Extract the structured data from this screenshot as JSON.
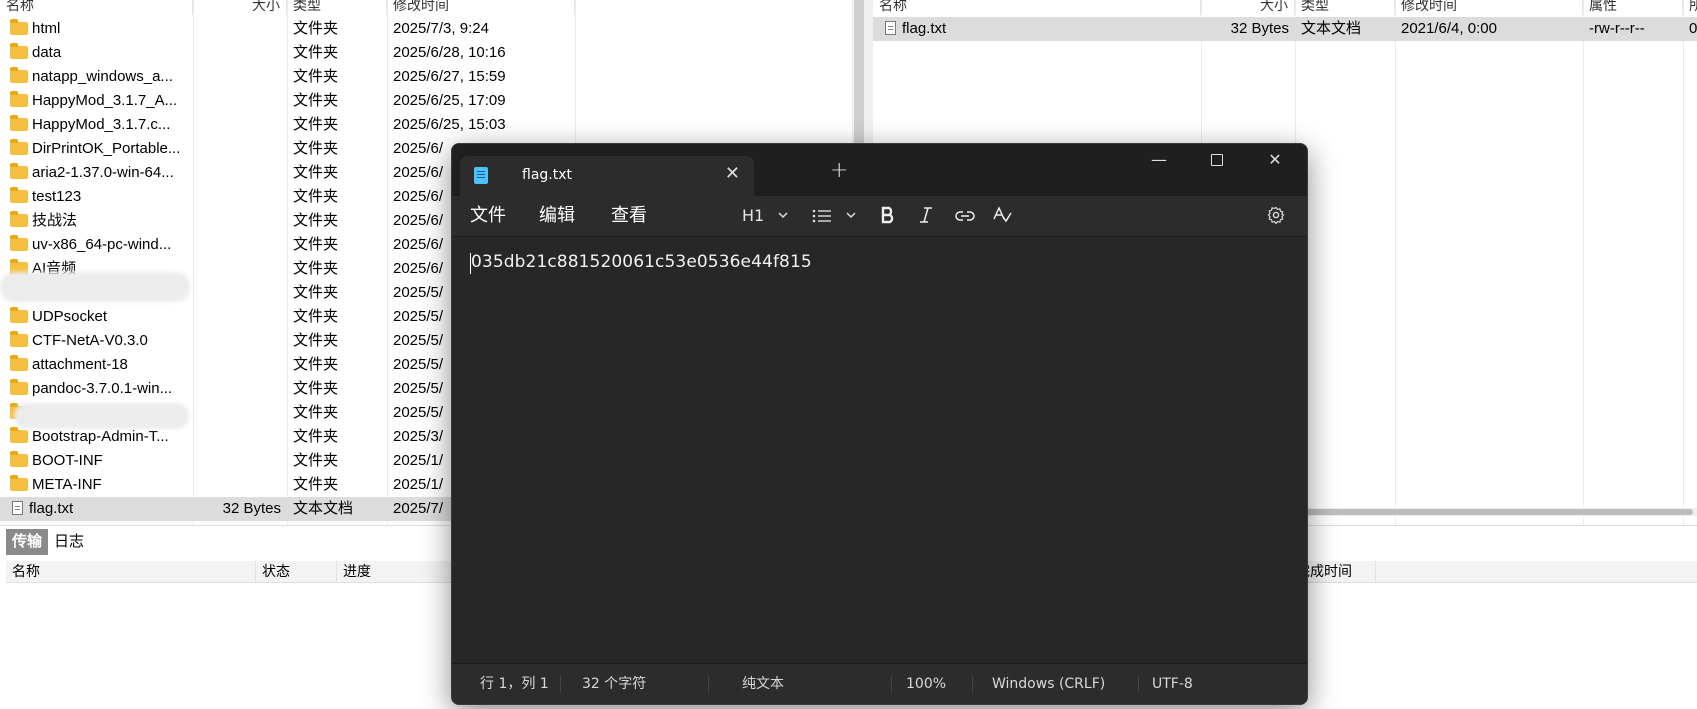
{
  "left_pane": {
    "columns": [
      "名称",
      "大小",
      "类型",
      "修改时间"
    ],
    "rows": [
      {
        "name": "html",
        "size": "",
        "type": "文件夹",
        "modified": "2025/7/3, 9:24",
        "icon": "folder-icon"
      },
      {
        "name": "data",
        "size": "",
        "type": "文件夹",
        "modified": "2025/6/28, 10:16",
        "icon": "folder-icon"
      },
      {
        "name": "natapp_windows_a...",
        "size": "",
        "type": "文件夹",
        "modified": "2025/6/27, 15:59",
        "icon": "folder-icon"
      },
      {
        "name": "HappyMod_3.1.7_A...",
        "size": "",
        "type": "文件夹",
        "modified": "2025/6/25, 17:09",
        "icon": "folder-icon"
      },
      {
        "name": "HappyMod_3.1.7.c...",
        "size": "",
        "type": "文件夹",
        "modified": "2025/6/25, 15:03",
        "icon": "folder-icon"
      },
      {
        "name": "DirPrintOK_Portable...",
        "size": "",
        "type": "文件夹",
        "modified": "2025/6/",
        "icon": "folder-icon"
      },
      {
        "name": "aria2-1.37.0-win-64...",
        "size": "",
        "type": "文件夹",
        "modified": "2025/6/",
        "icon": "folder-icon"
      },
      {
        "name": "test123",
        "size": "",
        "type": "文件夹",
        "modified": "2025/6/",
        "icon": "folder-icon"
      },
      {
        "name": "技战法",
        "size": "",
        "type": "文件夹",
        "modified": "2025/6/",
        "icon": "folder-icon"
      },
      {
        "name": "uv-x86_64-pc-wind...",
        "size": "",
        "type": "文件夹",
        "modified": "2025/6/",
        "icon": "folder-icon"
      },
      {
        "name": "AI音频",
        "size": "",
        "type": "文件夹",
        "modified": "2025/6/",
        "icon": "folder-icon"
      },
      {
        "name": "",
        "size": "",
        "type": "文件夹",
        "modified": "2025/5/",
        "icon": "folder-icon"
      },
      {
        "name": "UDPsocket",
        "size": "",
        "type": "文件夹",
        "modified": "2025/5/",
        "icon": "folder-icon"
      },
      {
        "name": "CTF-NetA-V0.3.0",
        "size": "",
        "type": "文件夹",
        "modified": "2025/5/",
        "icon": "folder-icon"
      },
      {
        "name": "attachment-18",
        "size": "",
        "type": "文件夹",
        "modified": "2025/5/",
        "icon": "folder-icon"
      },
      {
        "name": "pandoc-3.7.0.1-win...",
        "size": "",
        "type": "文件夹",
        "modified": "2025/5/",
        "icon": "folder-icon"
      },
      {
        "name": "",
        "size": "",
        "type": "文件夹",
        "modified": "2025/5/",
        "icon": "folder-icon"
      },
      {
        "name": "Bootstrap-Admin-T...",
        "size": "",
        "type": "文件夹",
        "modified": "2025/3/",
        "icon": "folder-icon"
      },
      {
        "name": "BOOT-INF",
        "size": "",
        "type": "文件夹",
        "modified": "2025/1/",
        "icon": "folder-icon"
      },
      {
        "name": "META-INF",
        "size": "",
        "type": "文件夹",
        "modified": "2025/1/",
        "icon": "folder-icon"
      },
      {
        "name": "flag.txt",
        "size": "32 Bytes",
        "type": "文本文档",
        "modified": "2025/7/",
        "icon": "text-file-icon",
        "selected": true
      }
    ]
  },
  "right_pane": {
    "columns": [
      "名称",
      "大小",
      "类型",
      "修改时间",
      "属性",
      "所"
    ],
    "rows": [
      {
        "name": "flag.txt",
        "size": "32 Bytes",
        "type": "文本文档",
        "modified": "2021/6/4, 0:00",
        "attributes": "-rw-r--r--",
        "owner": "0",
        "icon": "text-file-icon",
        "selected": true
      }
    ]
  },
  "bottom_panel": {
    "tabs": [
      "传输",
      "日志"
    ],
    "columns": [
      "名称",
      "状态",
      "进度",
      "完成时间"
    ]
  },
  "notepad": {
    "tab_title": "flag.txt",
    "new_tab": "+",
    "menus": [
      "文件",
      "编辑",
      "查看"
    ],
    "heading_dropdown": "H1",
    "content": "035db21c881520061c53e0536e44f815",
    "status": {
      "position": "行 1，列 1",
      "chars": "32 个字符",
      "format": "纯文本",
      "zoom": "100%",
      "line_ending": "Windows (CRLF)",
      "encoding": "UTF-8"
    },
    "colors": {
      "background": "#272727",
      "titlebar": "#1f1f1f",
      "accent": "#4cc2ff"
    }
  }
}
